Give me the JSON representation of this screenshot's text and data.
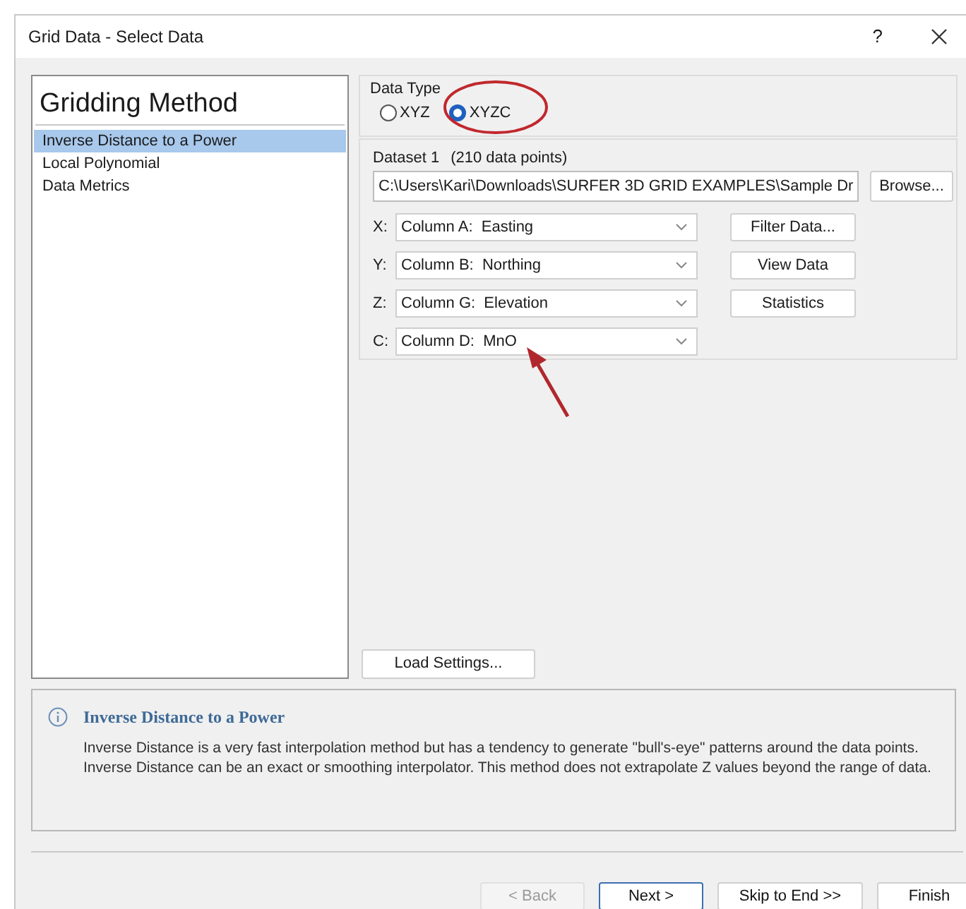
{
  "window": {
    "title": "Grid Data - Select Data",
    "help": "?"
  },
  "method_panel": {
    "heading": "Gridding Method",
    "items": [
      {
        "label": "Inverse Distance to a Power",
        "selected": true
      },
      {
        "label": "Local Polynomial",
        "selected": false
      },
      {
        "label": "Data Metrics",
        "selected": false
      }
    ]
  },
  "data_type": {
    "label": "Data Type",
    "options": [
      {
        "label": "XYZ",
        "selected": false
      },
      {
        "label": "XYZC",
        "selected": true
      }
    ]
  },
  "dataset": {
    "label": "Dataset 1",
    "count": "(210 data points)",
    "file_path": "C:\\Users\\Kari\\Downloads\\SURFER 3D GRID EXAMPLES\\Sample Dr",
    "browse": "Browse...",
    "columns": [
      {
        "axis": "X:",
        "value": "Column A:  Easting"
      },
      {
        "axis": "Y:",
        "value": "Column B:  Northing"
      },
      {
        "axis": "Z:",
        "value": "Column G:  Elevation"
      },
      {
        "axis": "C:",
        "value": "Column D:  MnO"
      }
    ],
    "buttons": [
      "Filter Data...",
      "View Data",
      "Statistics"
    ]
  },
  "load_settings": "Load Settings...",
  "info": {
    "title": "Inverse Distance to a Power",
    "text": "Inverse Distance is a very fast interpolation method but has a tendency to generate \"bull's-eye\" patterns around the data points. Inverse Distance can be an exact or smoothing interpolator. This method does not extrapolate Z values beyond the range of data."
  },
  "buttons": [
    {
      "label": "< Back",
      "disabled": true,
      "default": false
    },
    {
      "label": "Next >",
      "disabled": false,
      "default": true
    },
    {
      "label": "Skip to End >>",
      "disabled": false,
      "default": false
    },
    {
      "label": "Finish",
      "disabled": false,
      "default": false
    }
  ]
}
